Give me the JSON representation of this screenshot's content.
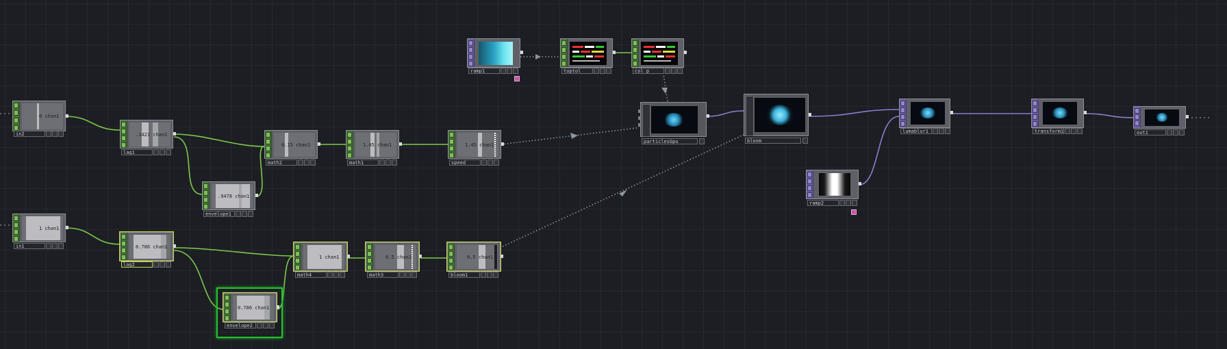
{
  "network": {
    "name": "network-editor"
  },
  "nodes": {
    "in2": {
      "label": "in2",
      "value": "0",
      "channel": "chan1"
    },
    "lag1": {
      "label": "lag1",
      "value": ".1421",
      "channel": "chan1"
    },
    "envelope1": {
      "label": "envelope1",
      "value": ".9478",
      "channel": "chan1"
    },
    "math2": {
      "label": "math2",
      "value": "0.15",
      "channel": "chan1"
    },
    "math1": {
      "label": "math1",
      "value": "1.45",
      "channel": "chan1"
    },
    "speed": {
      "label": "speed",
      "value": "1.45",
      "channel": "chan1"
    },
    "in1": {
      "label": "in1",
      "value": "1",
      "channel": "chan1"
    },
    "lag2": {
      "label": "lag2",
      "value": "0.786",
      "channel": "chan1"
    },
    "envelope2": {
      "label": "envelope2",
      "value": "0.786",
      "channel": "chan1"
    },
    "math4": {
      "label": "math4",
      "value": "1",
      "channel": "chan1"
    },
    "math3": {
      "label": "math3",
      "value": "0.5",
      "channel": "chan1"
    },
    "bloom1": {
      "label": "bloom1",
      "value": "0.5",
      "channel": "chan1"
    },
    "ramp1": {
      "label": "ramp1"
    },
    "toptol": {
      "label": "toptol"
    },
    "col_p": {
      "label": "col_p"
    },
    "particlesGpu": {
      "label": "particlesGpu"
    },
    "bloom": {
      "label": "bloom"
    },
    "lumablur1": {
      "label": "lumablur1"
    },
    "ramp2": {
      "label": "ramp2"
    },
    "transform1": {
      "label": "transform1"
    },
    "out1": {
      "label": "out1"
    }
  },
  "colors": {
    "background": "#1c1e24",
    "chop_wire": "#7ecb4a",
    "top_wire": "#8a7fd0",
    "export_wire": "#8d96a0",
    "chop_flag": "#7fbf58",
    "top_flag": "#9386c8",
    "selection": "#c9d64a",
    "current": "#25c42c",
    "particle": "#3fb6da"
  },
  "icons": {
    "bypass": "bypass-icon",
    "lock": "lock-icon",
    "display": "display-flag-icon",
    "viewer": "viewer-active-icon",
    "cook": "cook-flag-icon",
    "pin": "comment-pin-icon"
  }
}
